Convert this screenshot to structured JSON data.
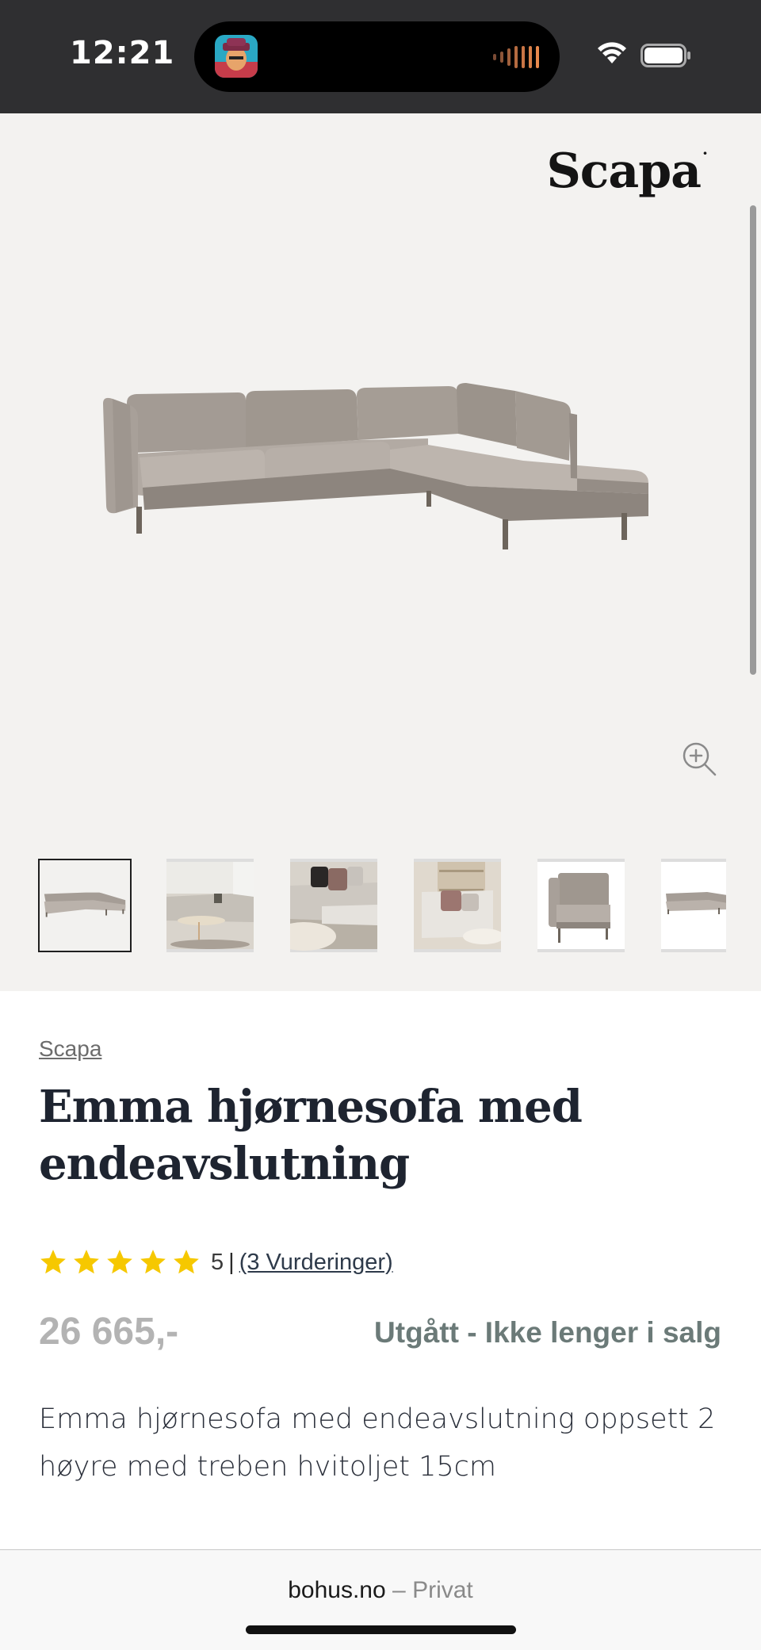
{
  "status_bar": {
    "time": "12:21",
    "icons": [
      "app-icon",
      "audio-bars-icon",
      "wifi-icon",
      "battery-icon"
    ]
  },
  "gallery": {
    "brand_logo": "Scapa",
    "hero_image": "corner-sofa-image",
    "zoom_icon": "zoom-in-icon",
    "thumbnails": [
      {
        "name": "thumbnail-1",
        "active": true
      },
      {
        "name": "thumbnail-2",
        "active": false
      },
      {
        "name": "thumbnail-3",
        "active": false
      },
      {
        "name": "thumbnail-4",
        "active": false
      },
      {
        "name": "thumbnail-5",
        "active": false
      },
      {
        "name": "thumbnail-6",
        "active": false
      }
    ]
  },
  "product": {
    "brand": "Scapa",
    "title": "Emma hjørnesofa med endeavslutning",
    "rating": {
      "stars": 5,
      "score": "5",
      "separator": "|",
      "reviews_label": "(3 Vurderinger)"
    },
    "price": "26 665,-",
    "availability": "Utgått - Ikke lenger i salg",
    "description": "Emma hjørnesofa med endeavslutning oppsett 2 høyre med treben hvitoljet 15cm"
  },
  "browser": {
    "domain": "bohus.no",
    "separator": "–",
    "mode": "Privat"
  },
  "colors": {
    "status_bar_bg": "#2f2f31",
    "gallery_bg": "#f3f2f0",
    "star": "#f6c800",
    "price": "#b3b3b3",
    "availability": "#6b7a78",
    "title": "#1e2430"
  }
}
